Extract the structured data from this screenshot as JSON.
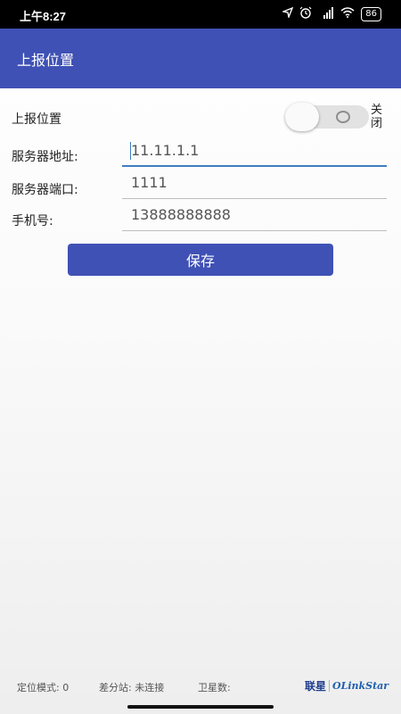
{
  "status_bar": {
    "time": "上午8:27",
    "icons": [
      "location-arrow-icon",
      "alarm-icon",
      "hd-signal-icon",
      "wifi-icon",
      "battery-icon"
    ],
    "hd_label": "HD",
    "battery_level": "86"
  },
  "app_bar": {
    "title": "上报位置",
    "color": "#3f51b5"
  },
  "form": {
    "report_label": "上报位置",
    "report_switch": {
      "on": false,
      "state_label": "关闭"
    },
    "server_address": {
      "label": "服务器地址:",
      "value": "11.11.1.1"
    },
    "server_port": {
      "label": "服务器端口:",
      "value": "1111"
    },
    "phone": {
      "label": "手机号:",
      "value": "13888888888"
    },
    "save_label": "保存"
  },
  "footer": {
    "positioning_mode": "定位模式: 0",
    "diff_station": "差分站: 未连接",
    "satellites": "卫星数:",
    "brand_cn": "联星",
    "brand_en": "OLinkStar"
  }
}
